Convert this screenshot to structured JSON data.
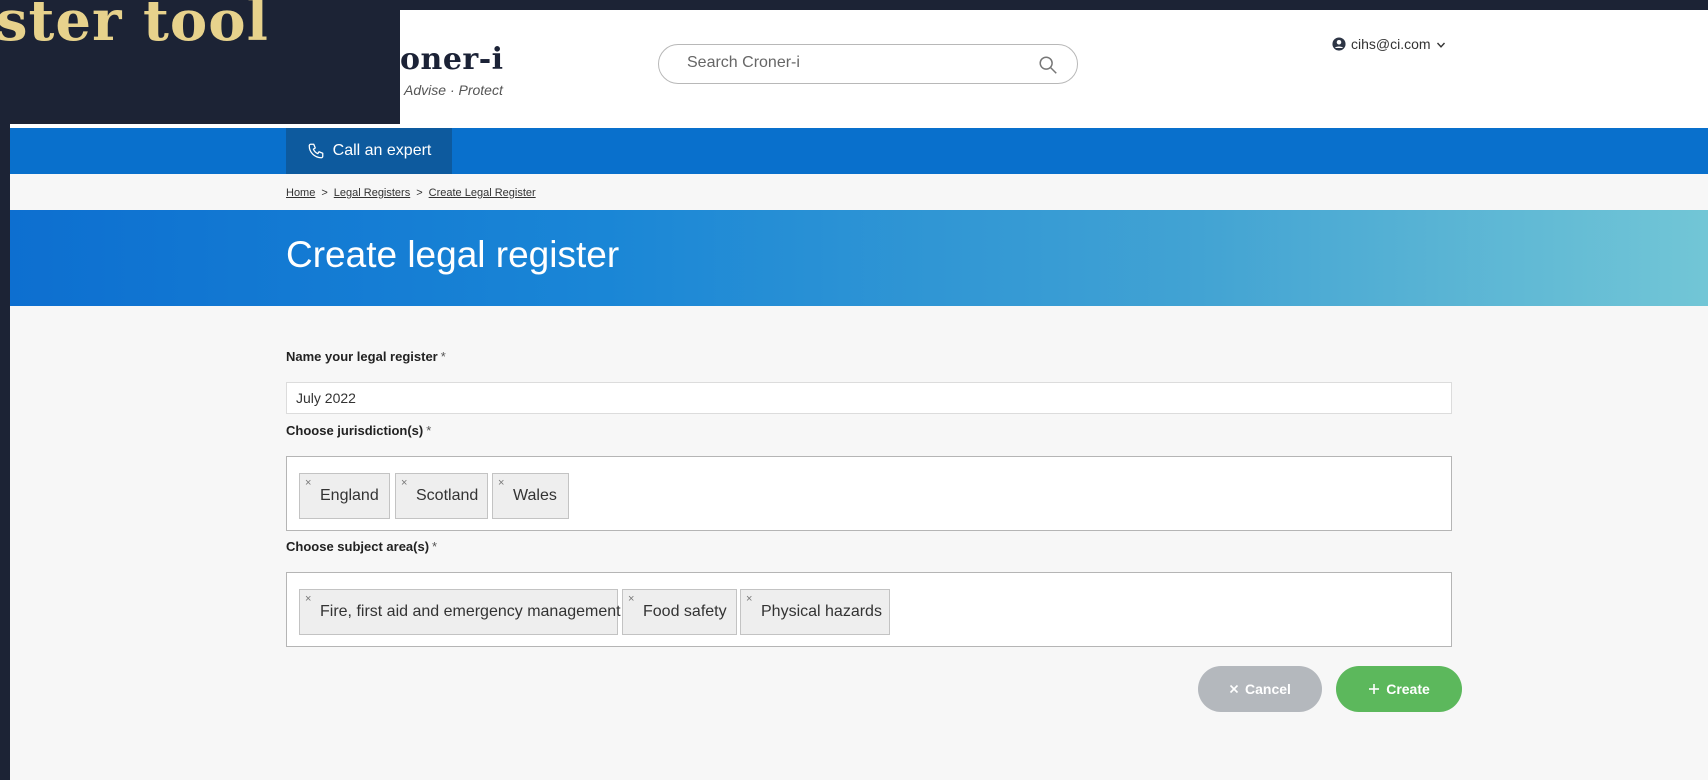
{
  "overlay": {
    "title": "ster tool"
  },
  "header": {
    "logo_name": "oner-i",
    "logo_tagline": "· Advise · Protect",
    "search_placeholder": "Search Croner-i",
    "user_email": "cihs@ci.com"
  },
  "navbar": {
    "call_label": "Call an expert"
  },
  "breadcrumb": {
    "items": [
      {
        "label": "Home"
      },
      {
        "label": "Legal Registers"
      },
      {
        "label": "Create Legal Register"
      }
    ],
    "separator": ">"
  },
  "banner": {
    "title": "Create legal register"
  },
  "form": {
    "name": {
      "label": "Name your legal register",
      "required": "*",
      "value": "July 2022"
    },
    "jurisdiction": {
      "label": "Choose jurisdiction(s)",
      "required": "*",
      "tags": [
        "England",
        "Scotland",
        "Wales"
      ]
    },
    "subject": {
      "label": "Choose subject area(s)",
      "required": "*",
      "tags": [
        "Fire, first aid and emergency management",
        "Food safety",
        "Physical hazards"
      ]
    },
    "tag_remove_glyph": "×",
    "cancel_label": "Cancel",
    "create_label": "Create"
  },
  "colors": {
    "page_background": "#1c2335",
    "nav_blue": "#0970cc",
    "call_button": "#0d5a9e",
    "cancel_button": "#b4b8bd",
    "create_button": "#5cb85c",
    "overlay_text": "#e7d28c"
  },
  "icons": {
    "search": "magnifier-icon",
    "user": "user-circle-icon",
    "dropdown": "chevron-down-icon",
    "call": "phone-icon",
    "tag_remove": "close-icon",
    "cancel": "close-icon",
    "create": "plus-icon"
  }
}
